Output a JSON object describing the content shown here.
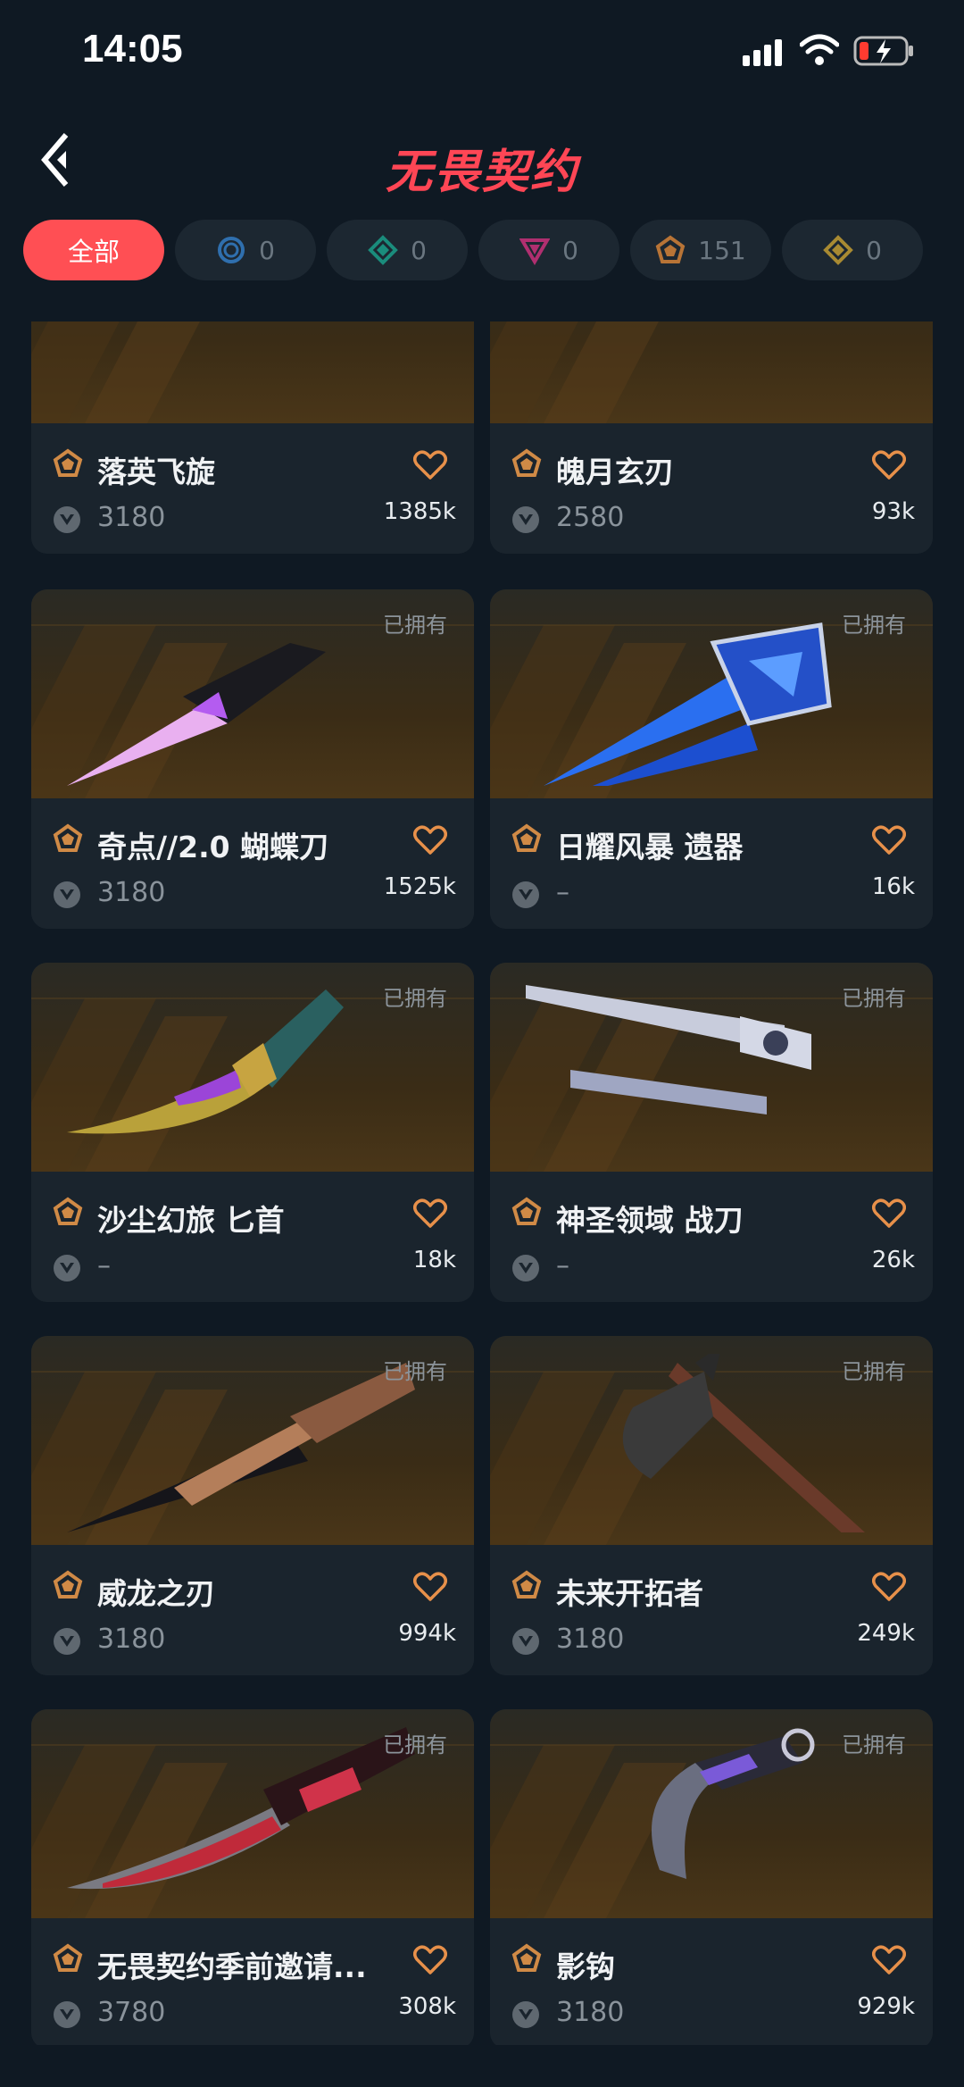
{
  "status": {
    "time": "14:05"
  },
  "header": {
    "title": "无畏契约"
  },
  "filters": [
    {
      "label": "全部",
      "count": "",
      "icon": "all",
      "active": true
    },
    {
      "label": "",
      "count": "0",
      "icon": "select-tier-icon",
      "color": "#3a7fc0"
    },
    {
      "label": "",
      "count": "0",
      "icon": "deluxe-tier-icon",
      "color": "#1e9c8a"
    },
    {
      "label": "",
      "count": "0",
      "icon": "premium-tier-icon",
      "color": "#c0337a"
    },
    {
      "label": "",
      "count": "151",
      "icon": "exclusive-tier-icon",
      "color": "#c07a3a"
    },
    {
      "label": "",
      "count": "0",
      "icon": "ultra-tier-icon",
      "color": "#c8a23a"
    }
  ],
  "cards": [
    {
      "name": "落英飞旋",
      "price": "3180",
      "likes": "1385k",
      "owned": "",
      "weapon": "butterfly-gold"
    },
    {
      "name": "魄月玄刃",
      "price": "2580",
      "likes": "93k",
      "owned": "",
      "weapon": "karambit-blue"
    },
    {
      "name": "奇点//2.0 蝴蝶刀",
      "price": "3180",
      "likes": "1525k",
      "owned": "已拥有",
      "weapon": "singularity"
    },
    {
      "name": "日耀风暴 遗器",
      "price": "–",
      "likes": "16k",
      "owned": "已拥有",
      "weapon": "sunstorm"
    },
    {
      "name": "沙尘幻旅 匕首",
      "price": "–",
      "likes": "18k",
      "owned": "已拥有",
      "weapon": "dagger-gold"
    },
    {
      "name": "神圣领域 战刀",
      "price": "–",
      "likes": "26k",
      "owned": "已拥有",
      "weapon": "blade-silver"
    },
    {
      "name": "威龙之刃",
      "price": "3180",
      "likes": "994k",
      "owned": "已拥有",
      "weapon": "dragon-blade"
    },
    {
      "name": "未来开拓者",
      "price": "3180",
      "likes": "249k",
      "owned": "已拥有",
      "weapon": "axe"
    },
    {
      "name": "无畏契约季前邀请...",
      "price": "3780",
      "likes": "308k",
      "owned": "已拥有",
      "weapon": "red-knife"
    },
    {
      "name": "影钩",
      "price": "3180",
      "likes": "929k",
      "owned": "已拥有",
      "weapon": "karambit-dark"
    }
  ]
}
